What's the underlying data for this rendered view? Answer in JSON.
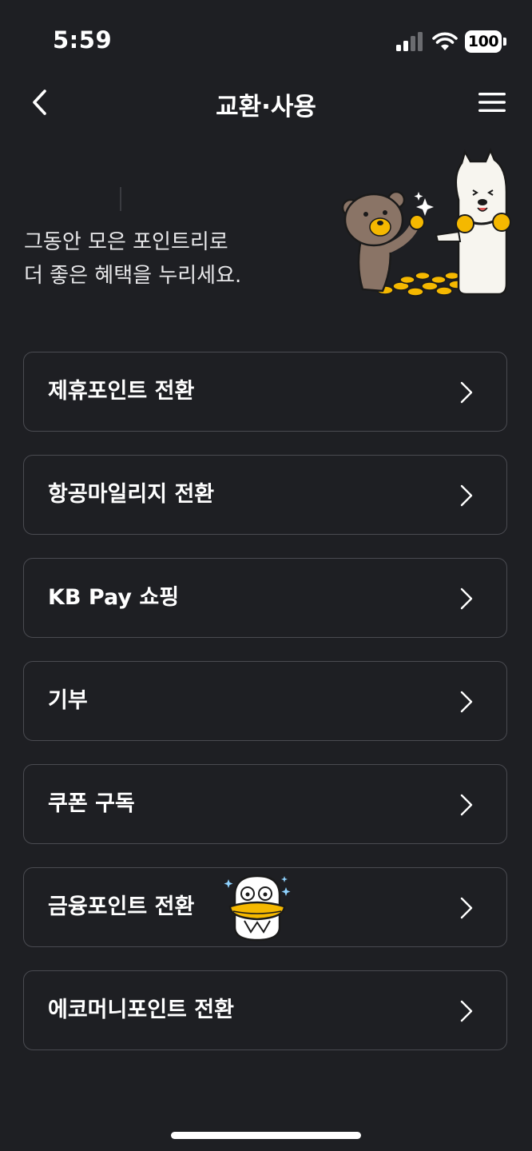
{
  "status_bar": {
    "time": "5:59",
    "battery": "100"
  },
  "header": {
    "title": "교환·사용"
  },
  "hero": {
    "line1": "그동안 모은 포인트리로",
    "line2": "더 좋은 혜택을 누리세요."
  },
  "menu": {
    "items": [
      {
        "label": "제휴포인트 전환"
      },
      {
        "label": "항공마일리지 전환"
      },
      {
        "label": "KB Pay 쇼핑"
      },
      {
        "label": "기부"
      },
      {
        "label": "쿠폰 구독"
      },
      {
        "label": "금융포인트 전환"
      },
      {
        "label": "에코머니포인트 전환"
      }
    ]
  },
  "colors": {
    "background": "#1e1f23",
    "card_border": "#4a4b51",
    "coin_gold": "#f5b800"
  }
}
